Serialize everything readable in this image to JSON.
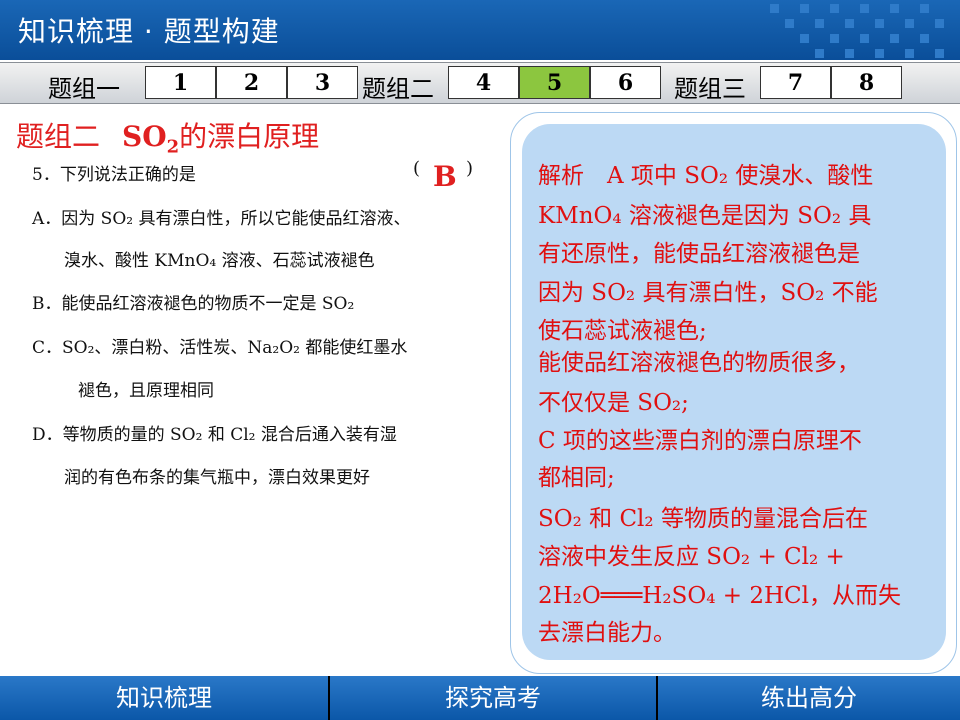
{
  "header": {
    "title": "知识梳理 · 题型构建"
  },
  "nav": {
    "groups": [
      {
        "label": "题组一",
        "items": [
          "1",
          "2",
          "3"
        ]
      },
      {
        "label": "题组二",
        "items": [
          "4",
          "5",
          "6"
        ]
      },
      {
        "label": "题组三",
        "items": [
          "7",
          "8"
        ]
      }
    ],
    "active": "5",
    "active_color": "#8cc63f"
  },
  "section": {
    "label": "题组二",
    "formula_prefix": "SO",
    "formula_sub": "2",
    "suffix": "的漂白原理"
  },
  "question": {
    "stem": "5．下列说法正确的是",
    "paren_open": "(",
    "paren_close": ")",
    "answer": "B",
    "opt_a_1": "A．因为 SO₂ 具有漂白性，所以它能使品红溶液、",
    "opt_a_2": "溴水、酸性 KMnO₄ 溶液、石蕊试液褪色",
    "opt_b": "B．能使品红溶液褪色的物质不一定是 SO₂",
    "opt_c_1": "C．SO₂、漂白粉、活性炭、Na₂O₂ 都能使红墨水",
    "opt_c_2": "褪色，且原理相同",
    "opt_d_1": "D．等物质的量的 SO₂ 和 Cl₂ 混合后通入装有湿",
    "opt_d_2": "润的有色布条的集气瓶中，漂白效果更好"
  },
  "explanation": {
    "line1": "解析　A 项中 SO₂ 使溴水、酸性",
    "line2": "KMnO₄ 溶液褪色是因为 SO₂ 具",
    "line3": "有还原性，能使品红溶液褪色是",
    "line4": "因为 SO₂ 具有漂白性，SO₂ 不能",
    "line5": "使石蕊试液褪色;",
    "line6": "能使品红溶液褪色的物质很多，",
    "line7": "不仅仅是 SO₂;",
    "line8": "C 项的这些漂白剂的漂白原理不",
    "line9": "都相同;",
    "line10": "SO₂ 和 Cl₂ 等物质的量混合后在",
    "line11": "溶液中发生反应 SO₂ + Cl₂ +",
    "line12": "2H₂O═══H₂SO₄ + 2HCl，从而失",
    "line13": "去漂白能力。"
  },
  "footer": {
    "items": [
      "知识梳理",
      "探究高考",
      "练出高分"
    ]
  },
  "colors": {
    "header_blue": "#0a4e99",
    "panel_blue": "#bcd9f4",
    "accent_red": "#e02020"
  }
}
